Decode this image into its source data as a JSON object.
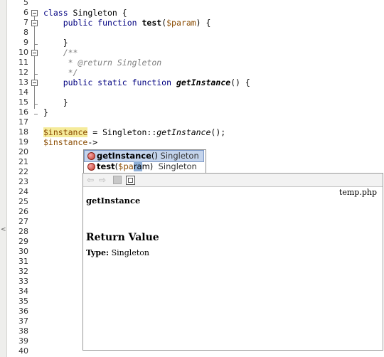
{
  "editor": {
    "line_numbers": [
      "5",
      "6",
      "7",
      "8",
      "9",
      "10",
      "11",
      "12",
      "13",
      "14",
      "15",
      "16",
      "17",
      "18",
      "19",
      "20",
      "21",
      "22",
      "23",
      "24",
      "25",
      "26",
      "27",
      "28",
      "29",
      "30",
      "31",
      "32",
      "33",
      "34",
      "35",
      "36",
      "37",
      "38",
      "39",
      "40"
    ],
    "code": {
      "l6": {
        "kw": "class",
        "rest": " Singleton {"
      },
      "l7": {
        "kw": "public function ",
        "name": "test",
        "open": "(",
        "param": "$param",
        "close": ") {"
      },
      "l9": "}",
      "l10": "/**",
      "l11": {
        "star": " * @return ",
        "type": "Singleton"
      },
      "l12": " */",
      "l13": {
        "kw": "public static function ",
        "name": "getInstance",
        "rest": "() {"
      },
      "l15": "}",
      "l16": "}",
      "l18": {
        "var": "$instance",
        "mid": " = Singleton::",
        "call": "getInstance",
        "end": "();"
      },
      "l19": {
        "var": "$instance",
        "arrow": "->"
      }
    }
  },
  "completion": {
    "items": [
      {
        "name": "getInstance",
        "args": "()",
        "type": "Singleton",
        "selected": true
      },
      {
        "name": "test",
        "args_open": "(",
        "param_a": "$pa",
        "param_cursor": "ra",
        "param_b": "m",
        "args_close": ")",
        "type": "Singleton",
        "selected": false
      }
    ]
  },
  "doc": {
    "file": "temp.php",
    "method": "getInstance",
    "heading": "Return Value",
    "type_label": "Type:",
    "type_value": "Singleton"
  }
}
